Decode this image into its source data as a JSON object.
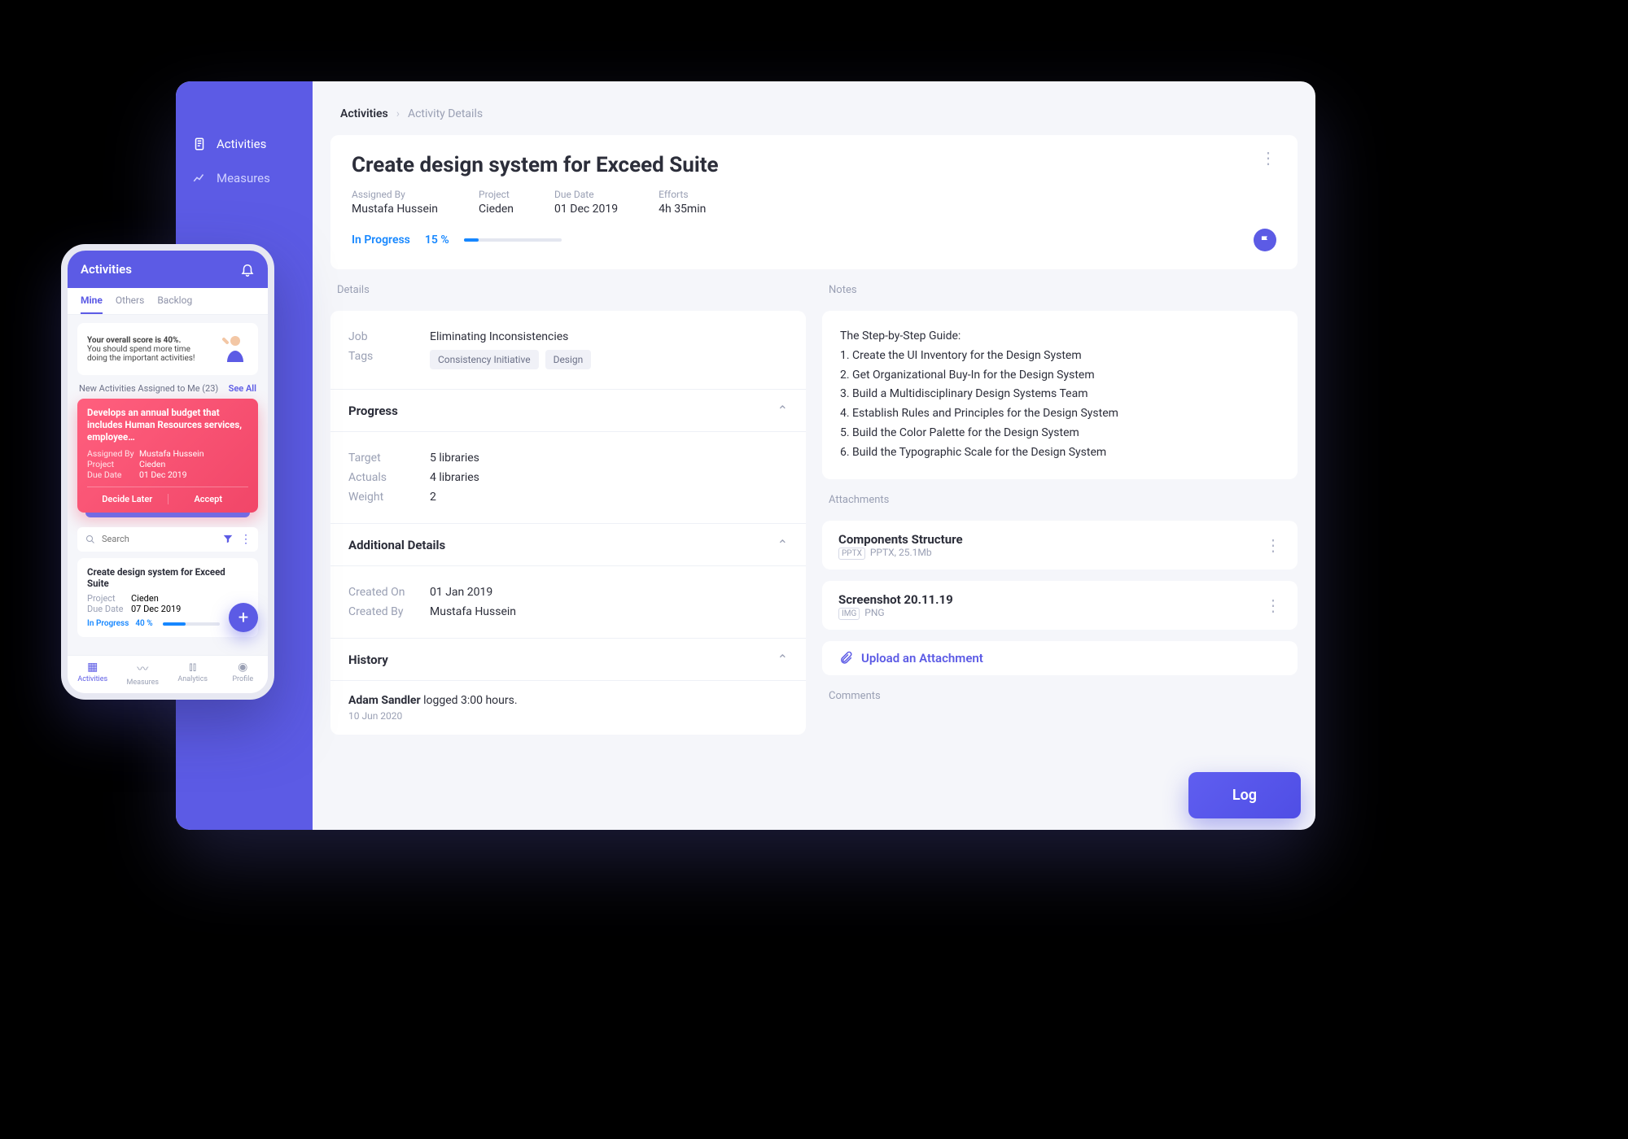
{
  "sidebar": {
    "items": [
      {
        "label": "Activities"
      },
      {
        "label": "Measures"
      }
    ]
  },
  "breadcrumb": {
    "root": "Activities",
    "leaf": "Activity Details"
  },
  "hero": {
    "title": "Create design system for Exceed Suite",
    "meta": [
      {
        "label": "Assigned By",
        "value": "Mustafa Hussein"
      },
      {
        "label": "Project",
        "value": "Cieden"
      },
      {
        "label": "Due Date",
        "value": "01 Dec 2019"
      },
      {
        "label": "Efforts",
        "value": "4h 35min"
      }
    ],
    "status": "In Progress",
    "percent_label": "15 %",
    "percent": 15
  },
  "sections": {
    "details": "Details",
    "notes": "Notes",
    "attachments": "Attachments",
    "comments": "Comments"
  },
  "details": {
    "job_label": "Job",
    "job": "Eliminating Inconsistencies",
    "tags_label": "Tags",
    "tags": [
      "Consistency Initiative",
      "Design"
    ]
  },
  "progress": {
    "title": "Progress",
    "target_label": "Target",
    "target": "5 libraries",
    "actuals_label": "Actuals",
    "actuals": "4 libraries",
    "weight_label": "Weight",
    "weight": "2"
  },
  "additional": {
    "title": "Additional Details",
    "created_on_label": "Created On",
    "created_on": "01 Jan 2019",
    "created_by_label": "Created By",
    "created_by": "Mustafa Hussein"
  },
  "history": {
    "title": "History",
    "actor": "Adam Sandler",
    "rest": " logged 3:00 hours.",
    "date": "10 Jun 2020"
  },
  "notes": [
    "The Step-by-Step Guide:",
    "1. Create the UI Inventory for the Design System",
    "2. Get Organizational Buy-In for the Design System",
    "3. Build a Multidisciplinary Design Systems Team",
    "4. Establish Rules and Principles for the Design System",
    "5. Build the Color Palette for the Design System",
    "6. Build the Typographic Scale for the Design System"
  ],
  "attachments": [
    {
      "title": "Components Structure",
      "badge": "PPTX",
      "meta": "PPTX, 25.1Mb"
    },
    {
      "title": "Screenshot 20.11.19",
      "badge": "IMG",
      "meta": "PNG"
    }
  ],
  "upload_label": "Upload an Attachment",
  "log_label": "Log",
  "phone": {
    "header": "Activities",
    "tabs": [
      "Mine",
      "Others",
      "Backlog"
    ],
    "tip_bold": "Your overall score is 40%.",
    "tip_rest": "You should spend more time doing the important activities!",
    "assigned_title": "New Activities Assigned to Me (23)",
    "see_all": "See All",
    "red": {
      "title": "Develops an annual budget that includes Human Resources services, employee…",
      "assigned_by_label": "Assigned By",
      "assigned_by": "Mustafa Hussein",
      "project_label": "Project",
      "project": "Cieden",
      "due_date_label": "Due Date",
      "due_date": "01 Dec 2019",
      "decide": "Decide Later",
      "accept": "Accept"
    },
    "search_placeholder": "Search",
    "card": {
      "title": "Create design system for Exceed Suite",
      "project_label": "Project",
      "project": "Cieden",
      "due_date_label": "Due Date",
      "due_date": "07 Dec 2019",
      "status": "In Progress",
      "percent_label": "40 %",
      "percent": 40
    },
    "nav": [
      "Activities",
      "Measures",
      "Analytics",
      "Profile"
    ]
  }
}
